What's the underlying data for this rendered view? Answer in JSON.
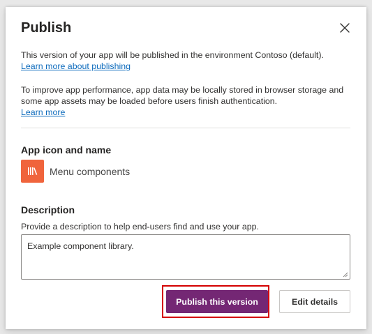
{
  "dialog": {
    "title": "Publish",
    "intro_text": "This version of your app will be published in the environment Contoso (default).",
    "intro_link": "Learn more about publishing",
    "perf_text": "To improve app performance, app data may be locally stored in browser storage and some app assets may be loaded before users finish authentication.",
    "perf_link": "Learn more"
  },
  "app": {
    "heading": "App icon and name",
    "name": "Menu components",
    "icon": "library-books-icon",
    "icon_color": "#f0643c"
  },
  "description": {
    "heading": "Description",
    "hint": "Provide a description to help end-users find and use your app.",
    "value": "Example component library."
  },
  "actions": {
    "primary_label": "Publish this version",
    "secondary_label": "Edit details",
    "primary_color": "#742774",
    "highlight_color": "#d40000"
  }
}
